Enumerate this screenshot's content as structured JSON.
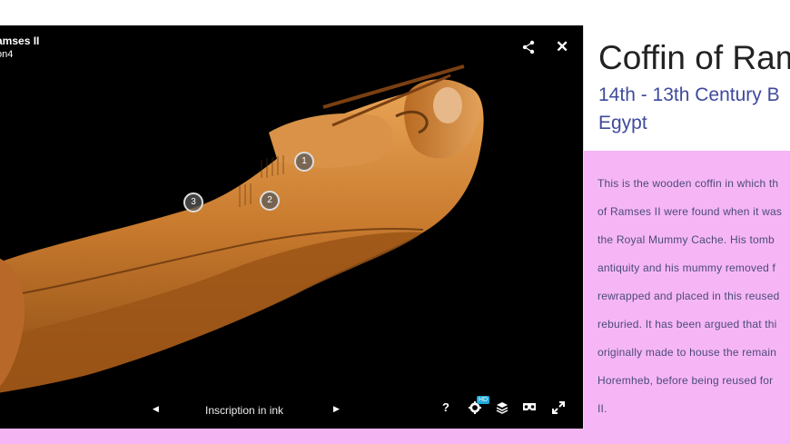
{
  "viewer": {
    "title_line1": "amses II",
    "title_line2": "on4",
    "annotation_label": "Inscription in ink",
    "prev_icon": "◀",
    "next_icon": "▶",
    "help_icon": "?",
    "hd_badge": "HD",
    "close_icon": "✕",
    "hotspots": [
      "1",
      "2",
      "3"
    ]
  },
  "panel": {
    "title": "Coffin of Ram",
    "date": "14th - 13th Century B",
    "location": "Egypt",
    "description_lines": [
      "This is the wooden coffin in which th",
      "of Ramses II were found when it was",
      "the Royal Mummy Cache. His tomb",
      "antiquity and his mummy removed f",
      "rewrapped and placed in this reused",
      "reburied. It has been argued that thi",
      "originally made to house the remain",
      "Horemheb, before being reused for",
      "II."
    ]
  },
  "colors": {
    "accent": "#f6b6f6",
    "heading_blue": "#3f4a9c",
    "viewer_bg": "#000000",
    "hd_badge": "#1caad9"
  }
}
